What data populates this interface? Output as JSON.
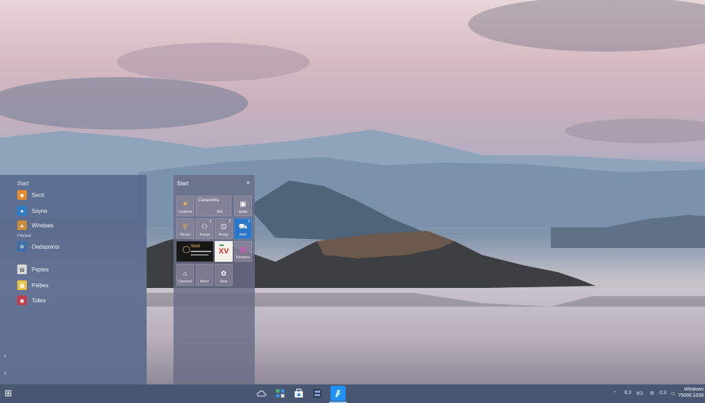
{
  "start_list": {
    "header": "Start",
    "apps": [
      {
        "label": "Sectt",
        "icon": "app-icon-orange",
        "color": "#e58a2c"
      },
      {
        "label": "Soyne",
        "icon": "person-icon",
        "color": "#2b7dc7"
      },
      {
        "label": "Wirebats",
        "icon": "landscape-icon",
        "color": "#c98a3a"
      },
      {
        "label": "Oedspoints",
        "icon": "settings-icon",
        "color": "#3d6fa8"
      },
      {
        "label": "Peptes",
        "icon": "document-icon",
        "color": "#d9d9d9"
      },
      {
        "label": "Pelbes",
        "icon": "calendar-icon",
        "color": "#e8c04a"
      },
      {
        "label": "Tolles",
        "icon": "media-icon",
        "color": "#c23b4a"
      }
    ],
    "group_label": "Frecied",
    "chevrons": [
      "‹",
      "‹"
    ]
  },
  "tiles_panel": {
    "header": "Start",
    "close": "×",
    "tiles": [
      {
        "label": "Canbenis",
        "glyph": "★"
      },
      {
        "label": "Canacetiva",
        "top": true
      },
      {
        "label": "Bell",
        "glyph": ""
      },
      {
        "label": "Gettis",
        "glyph": "▣"
      },
      {
        "label": "Pinses",
        "glyph": "⚲"
      },
      {
        "label": "Travas",
        "glyph": "⚇",
        "badge": "1"
      },
      {
        "label": "Rosgy",
        "glyph": "⊡",
        "badge": "2"
      },
      {
        "label": "Beta",
        "glyph": "⛟",
        "badge": "2"
      },
      {
        "label": "Sitelt",
        "wide": true
      },
      {
        "label": "XV",
        "glyph": "XV"
      },
      {
        "label": "Ressterells",
        "glyph": "▦"
      },
      {
        "label": "Carchcns",
        "glyph": "⌂"
      },
      {
        "label": "Brent",
        "glyph": ""
      },
      {
        "label": "Sess",
        "glyph": "✿"
      }
    ]
  },
  "taskbar": {
    "start_glyph": "⊞",
    "pinned": [
      "cloud-icon",
      "apps-icon",
      "store-icon",
      "files-icon",
      "edge-icon"
    ],
    "tray": [
      "8.3",
      "⊘3",
      "⚙",
      "0.3"
    ],
    "clock_line1": "Windows",
    "clock_line2": "75000.1039"
  },
  "colors": {
    "accent": "#1e90ff",
    "panel": "#56688c",
    "taskbar": "#465470"
  }
}
